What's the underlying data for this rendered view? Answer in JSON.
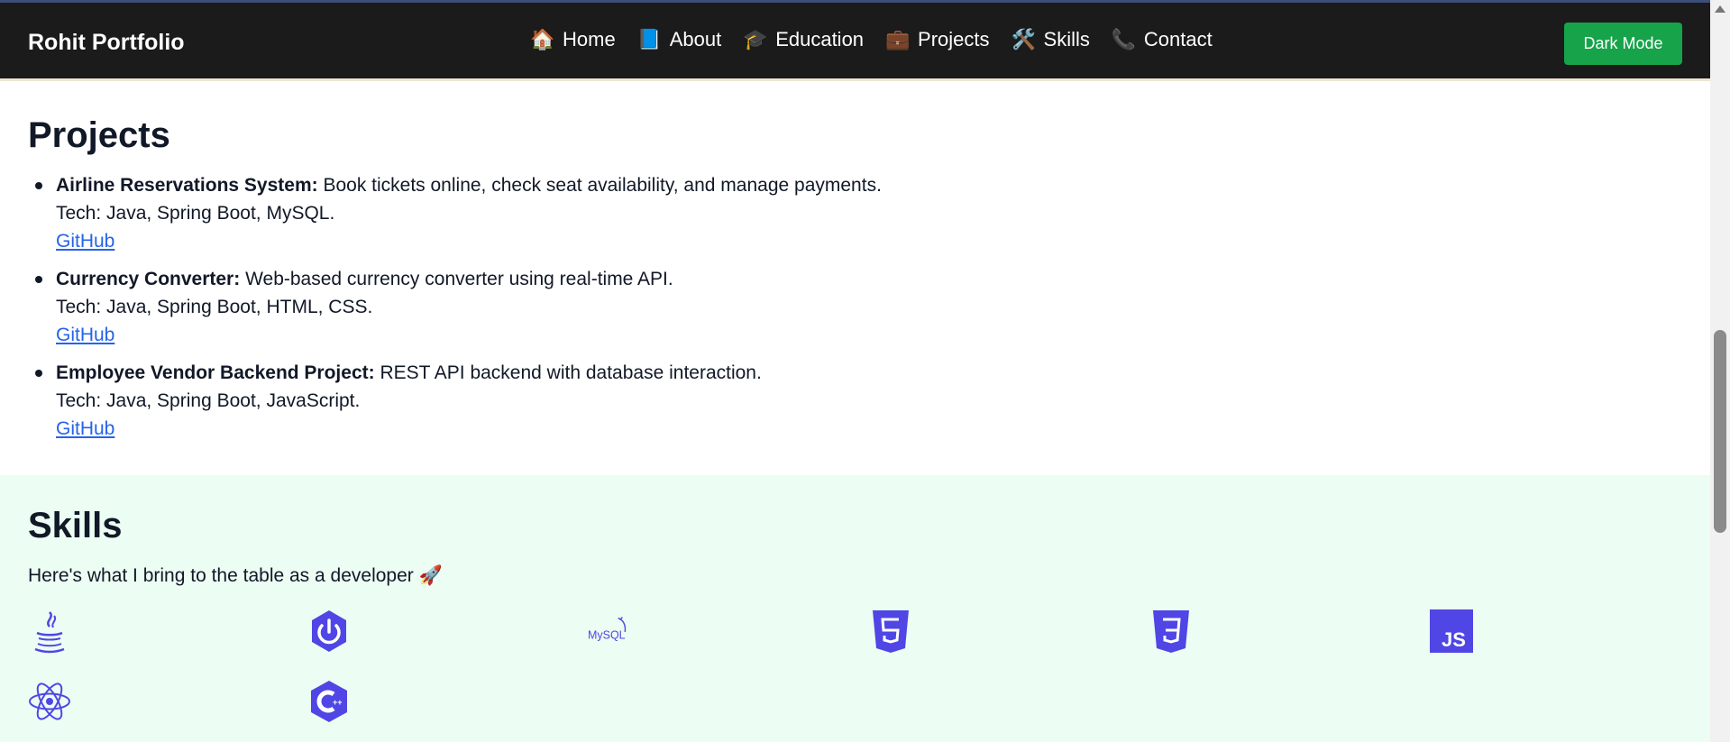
{
  "nav": {
    "brand": "Rohit Portfolio",
    "items": [
      {
        "icon": "🏠",
        "label": "Home"
      },
      {
        "icon": "📘",
        "label": "About"
      },
      {
        "icon": "🎓",
        "label": "Education"
      },
      {
        "icon": "💼",
        "label": "Projects"
      },
      {
        "icon": "🛠️",
        "label": "Skills"
      },
      {
        "icon": "📞",
        "label": "Contact"
      }
    ],
    "dark_mode_label": "Dark Mode"
  },
  "projects": {
    "title": "Projects",
    "items": [
      {
        "name": "Airline Reservations System:",
        "desc": " Book tickets online, check seat availability, and manage payments.",
        "tech": "Tech: Java, Spring Boot, MySQL.",
        "link": "GitHub"
      },
      {
        "name": "Currency Converter:",
        "desc": " Web-based currency converter using real-time API.",
        "tech": "Tech: Java, Spring Boot, HTML, CSS.",
        "link": "GitHub"
      },
      {
        "name": "Employee Vendor Backend Project:",
        "desc": " REST API backend with database interaction.",
        "tech": "Tech: Java, Spring Boot, JavaScript.",
        "link": "GitHub"
      }
    ]
  },
  "skills": {
    "title": "Skills",
    "subtitle": "Here's what I bring to the table as a developer 🚀",
    "icons": [
      "java-icon",
      "spring-icon",
      "mysql-icon",
      "html5-icon",
      "css3-icon",
      "javascript-icon",
      "react-icon",
      "cplusplus-icon"
    ],
    "icon_color": "#4f46e5"
  }
}
